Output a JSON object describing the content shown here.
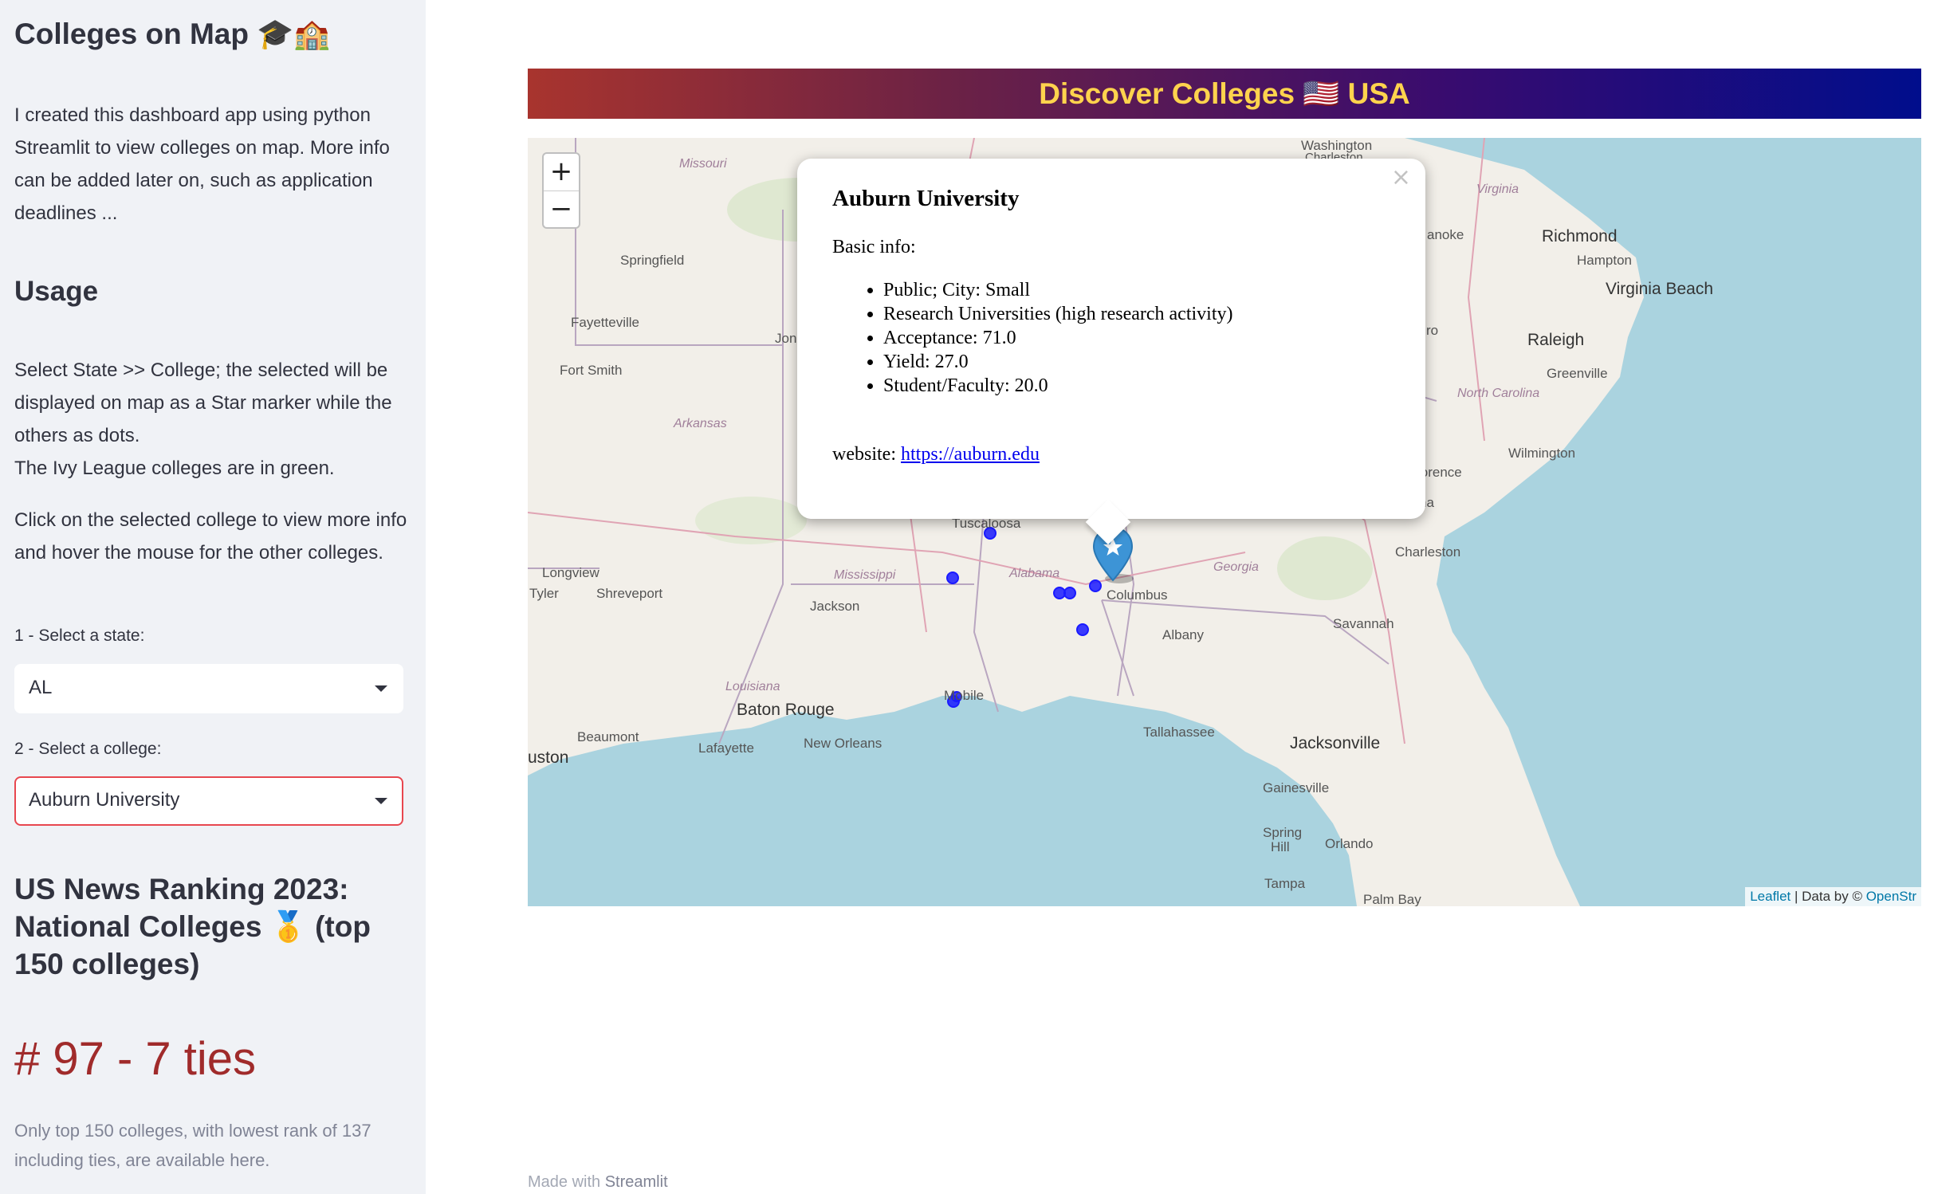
{
  "sidebar": {
    "title": "Colleges on Map 🎓🏫",
    "intro": "I created this dashboard app using python Streamlit to view colleges on map. More info can be added later on, such as application deadlines ...",
    "usage_heading": "Usage",
    "usage_text_1": "Select State >> College; the selected will be displayed on map as a Star marker while the others as dots.",
    "usage_text_2": "The Ivy League colleges are in green.",
    "usage_text_3": "Click on the selected college to view more info and hover the mouse for the other colleges.",
    "state_label": "1 - Select a state:",
    "state_value": "AL",
    "college_label": "2 - Select a college:",
    "college_value": "Auburn University",
    "ranking_heading": "US News Ranking 2023: National Colleges 🥇 (top 150 colleges)",
    "ranking_value": "# 97 - 7 ties",
    "ranking_note": "Only top 150 colleges, with lowest rank of 137 including ties, are available here."
  },
  "main": {
    "banner": "Discover Colleges 🇺🇸 USA",
    "footer_prefix": "Made with",
    "footer_brand": "Streamlit"
  },
  "map": {
    "zoom_in": "+",
    "zoom_out": "−",
    "attribution_leaflet": "Leaflet",
    "attribution_text": " | Data by © ",
    "attribution_osm": "OpenStr",
    "labels": {
      "washington": "Washington",
      "charleston_wv": "Charleston",
      "missouri": "Missouri",
      "virginia": "Virginia",
      "roanoke": "anoke",
      "richmond": "Richmond",
      "hampton": "Hampton",
      "virginia_beach": "Virginia Beach",
      "springfield": "Springfield",
      "fayetteville": "Fayetteville",
      "jon": "Jon",
      "raleigh": "Raleigh",
      "greenville": "Greenville",
      "fort_smith": "Fort Smith",
      "north_carolina": "North Carolina",
      "arkansas": "Arkansas",
      "wilmington": "Wilmington",
      "florence": "lorence",
      "charleston_sc": "Charleston",
      "tuscaloosa": "Tuscaloosa",
      "longview": "Longview",
      "tyler": "Tyler",
      "shreveport": "Shreveport",
      "mississippi": "Mississippi",
      "alabama": "Alabama",
      "jackson": "Jackson",
      "columbus": "Columbus",
      "georgia": "Georgia",
      "savannah": "Savannah",
      "albany": "Albany",
      "louisiana": "Louisiana",
      "mobile": "Mobile",
      "baton_rouge": "Baton Rouge",
      "beaumont": "Beaumont",
      "lafayette": "Lafayette",
      "new_orleans": "New Orleans",
      "tallahassee": "Tallahassee",
      "jacksonville": "Jacksonville",
      "houston": "uston",
      "gainesville": "Gainesville",
      "spring_hill_1": "Spring",
      "spring_hill_2": "Hill",
      "orlando": "Orlando",
      "tampa": "Tampa",
      "palm_bay": "Palm Bay",
      "ro": "ro",
      "na": "na"
    },
    "popup": {
      "close": "×",
      "title": "Auburn University",
      "basic_info": "Basic info:",
      "items": [
        "Public; City: Small",
        "Research Universities (high research activity)",
        "Acceptance: 71.0",
        "Yield: 27.0",
        "Student/Faculty: 20.0"
      ],
      "website_label": "website: ",
      "website_url": "https://auburn.edu"
    },
    "colors": {
      "water": "#aad3df",
      "land": "#f2efe9",
      "dot": "#1a1aff",
      "marker": "#3d94d6"
    },
    "marker_icon": "star-icon"
  }
}
